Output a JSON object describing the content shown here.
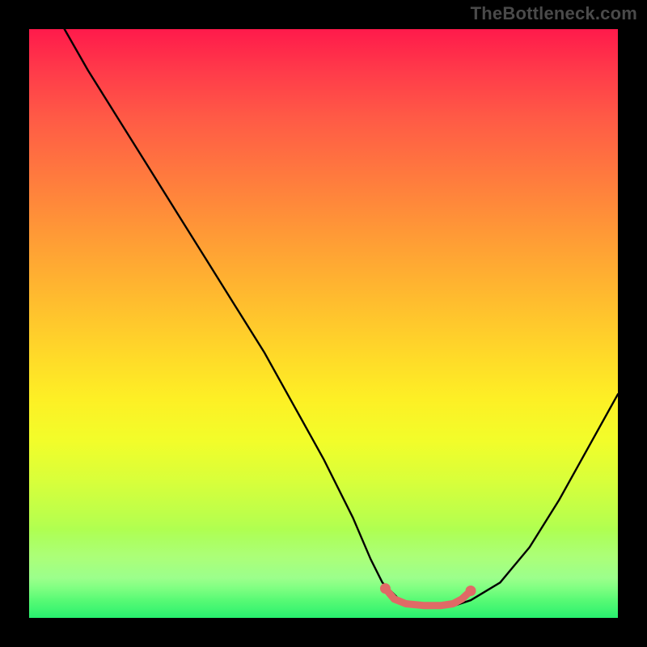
{
  "watermark": "TheBottleneck.com",
  "chart_data": {
    "type": "line",
    "title": "",
    "xlabel": "",
    "ylabel": "",
    "xlim": [
      0,
      100
    ],
    "ylim": [
      0,
      100
    ],
    "grid": false,
    "legend": false,
    "series": [
      {
        "name": "bottleneck-curve",
        "x": [
          6,
          10,
          15,
          20,
          25,
          30,
          35,
          40,
          45,
          50,
          55,
          58,
          60,
          63,
          67,
          70,
          72,
          75,
          80,
          85,
          90,
          95,
          100
        ],
        "y": [
          100,
          93,
          85,
          77,
          69,
          61,
          53,
          45,
          36,
          27,
          17,
          10,
          6,
          3,
          2,
          2,
          2,
          3,
          6,
          12,
          20,
          29,
          38
        ]
      }
    ],
    "highlight_segment": {
      "name": "flat-minimum",
      "color": "#e06a66",
      "points": [
        {
          "x": 60.5,
          "y": 5.0
        },
        {
          "x": 62.0,
          "y": 3.2
        },
        {
          "x": 64.0,
          "y": 2.4
        },
        {
          "x": 67.0,
          "y": 2.1
        },
        {
          "x": 70.0,
          "y": 2.1
        },
        {
          "x": 72.0,
          "y": 2.4
        },
        {
          "x": 73.5,
          "y": 3.2
        },
        {
          "x": 75.0,
          "y": 4.6
        }
      ],
      "endpoint_markers": [
        {
          "x": 60.5,
          "y": 5.0
        },
        {
          "x": 75.0,
          "y": 4.6
        }
      ]
    },
    "gradient_stops": [
      {
        "pos": 0,
        "color": "#ff1a4b"
      },
      {
        "pos": 50,
        "color": "#ffd829"
      },
      {
        "pos": 100,
        "color": "#27f06e"
      }
    ]
  }
}
